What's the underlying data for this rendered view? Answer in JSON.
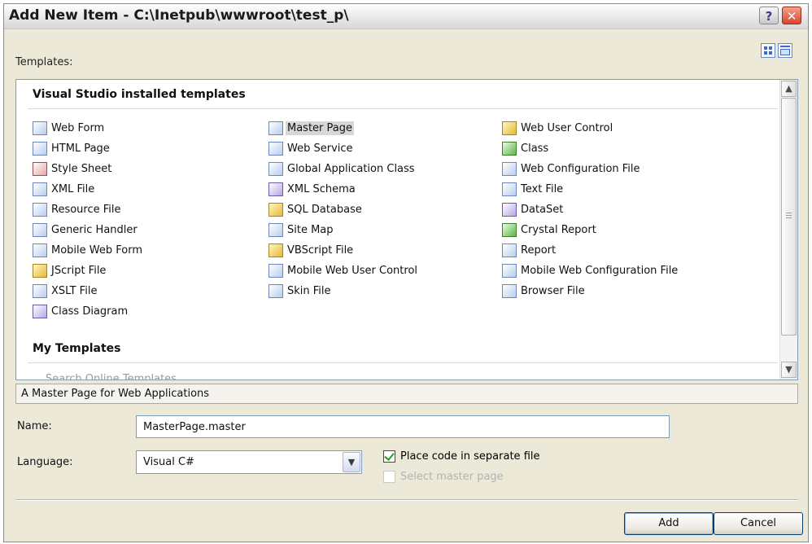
{
  "window": {
    "title": "Add New Item - C:\\Inetpub\\wwwroot\\test_p\\",
    "help_glyph": "?",
    "close_glyph": "✕"
  },
  "templates": {
    "label": "Templates:",
    "groups": [
      {
        "header": "Visual Studio installed templates",
        "columns": [
          [
            "Web Form",
            "HTML Page",
            "Style Sheet",
            "XML File",
            "Resource File",
            "Generic Handler",
            "Mobile Web Form",
            "JScript File",
            "XSLT File",
            "Class Diagram"
          ],
          [
            "Master Page",
            "Web Service",
            "Global Application Class",
            "XML Schema",
            "SQL Database",
            "Site Map",
            "VBScript File",
            "Mobile Web User Control",
            "Skin File"
          ],
          [
            "Web User Control",
            "Class",
            "Web Configuration File",
            "Text File",
            "DataSet",
            "Crystal Report",
            "Report",
            "Mobile Web Configuration File",
            "Browser File"
          ]
        ]
      },
      {
        "header": "My Templates",
        "items": [
          "Search Online Templates..."
        ]
      }
    ],
    "selected": "Master Page"
  },
  "description": "A Master Page for Web Applications",
  "form": {
    "name_label": "Name:",
    "name_value": "MasterPage.master",
    "language_label": "Language:",
    "language_value": "Visual C#",
    "place_code_label": "Place code in separate file",
    "place_code_checked": true,
    "select_master_label": "Select master page",
    "select_master_checked": false
  },
  "buttons": {
    "add": "Add",
    "cancel": "Cancel"
  }
}
